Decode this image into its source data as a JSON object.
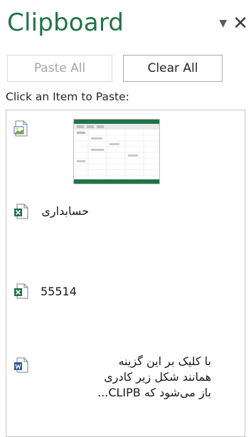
{
  "pane": {
    "title": "Clipboard",
    "dropdown_icon": "▼",
    "close_icon": "✕"
  },
  "toolbar": {
    "paste_all_label": "Paste All",
    "clear_all_label": "Clear All"
  },
  "hint_text": "Click an Item to Paste:",
  "items": [
    {
      "type": "image",
      "icon": "picture-doc-icon"
    },
    {
      "type": "excel",
      "icon": "excel-doc-icon",
      "text": "حسابداری"
    },
    {
      "type": "excel",
      "icon": "excel-doc-icon",
      "text": "55514"
    },
    {
      "type": "word",
      "icon": "word-doc-icon",
      "lines": [
        "با کلیک بر این گزینه",
        "همانند شکل زیر کادری",
        "باز می‌شود که CLIPB..."
      ]
    }
  ],
  "colors": {
    "title": "#217346",
    "excel": "#1e7145",
    "word": "#2b579a"
  }
}
